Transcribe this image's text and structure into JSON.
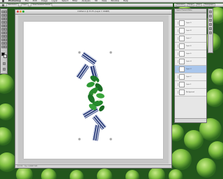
{
  "menubar": {
    "app_name": "Photoshop",
    "items": [
      "File",
      "Edit",
      "Image",
      "Layer",
      "Select",
      "Filter",
      "Analysis",
      "3D",
      "View",
      "Window",
      "Help"
    ]
  },
  "options_bar": {
    "items": [
      "Auto-Select",
      "Layer",
      "Show Transform Controls"
    ]
  },
  "workspace_bar": {
    "buttons": [
      "Essentials",
      "Design",
      "Paint",
      "Photography"
    ]
  },
  "document": {
    "title": "Untitled-1 @ 33.3% (Layer 7, RGB/8)",
    "zoom": "33.33%",
    "status": "Doc: 5.49M/27.4M"
  },
  "layers_panel": {
    "tabs": "Layers  Channels  Paths",
    "layers": [
      "Layer 9",
      "Layer 8",
      "Layer 7",
      "Layer 6",
      "Layer 5",
      "Layer 4",
      "Layer 3",
      "Layer 2",
      "Layer 1",
      "Background"
    ],
    "selected_index": 6
  },
  "colors": {
    "foreground": "#000000",
    "background": "#ffffff",
    "selection": "#a9c6ec",
    "wallpaper": "#2f7a28"
  }
}
